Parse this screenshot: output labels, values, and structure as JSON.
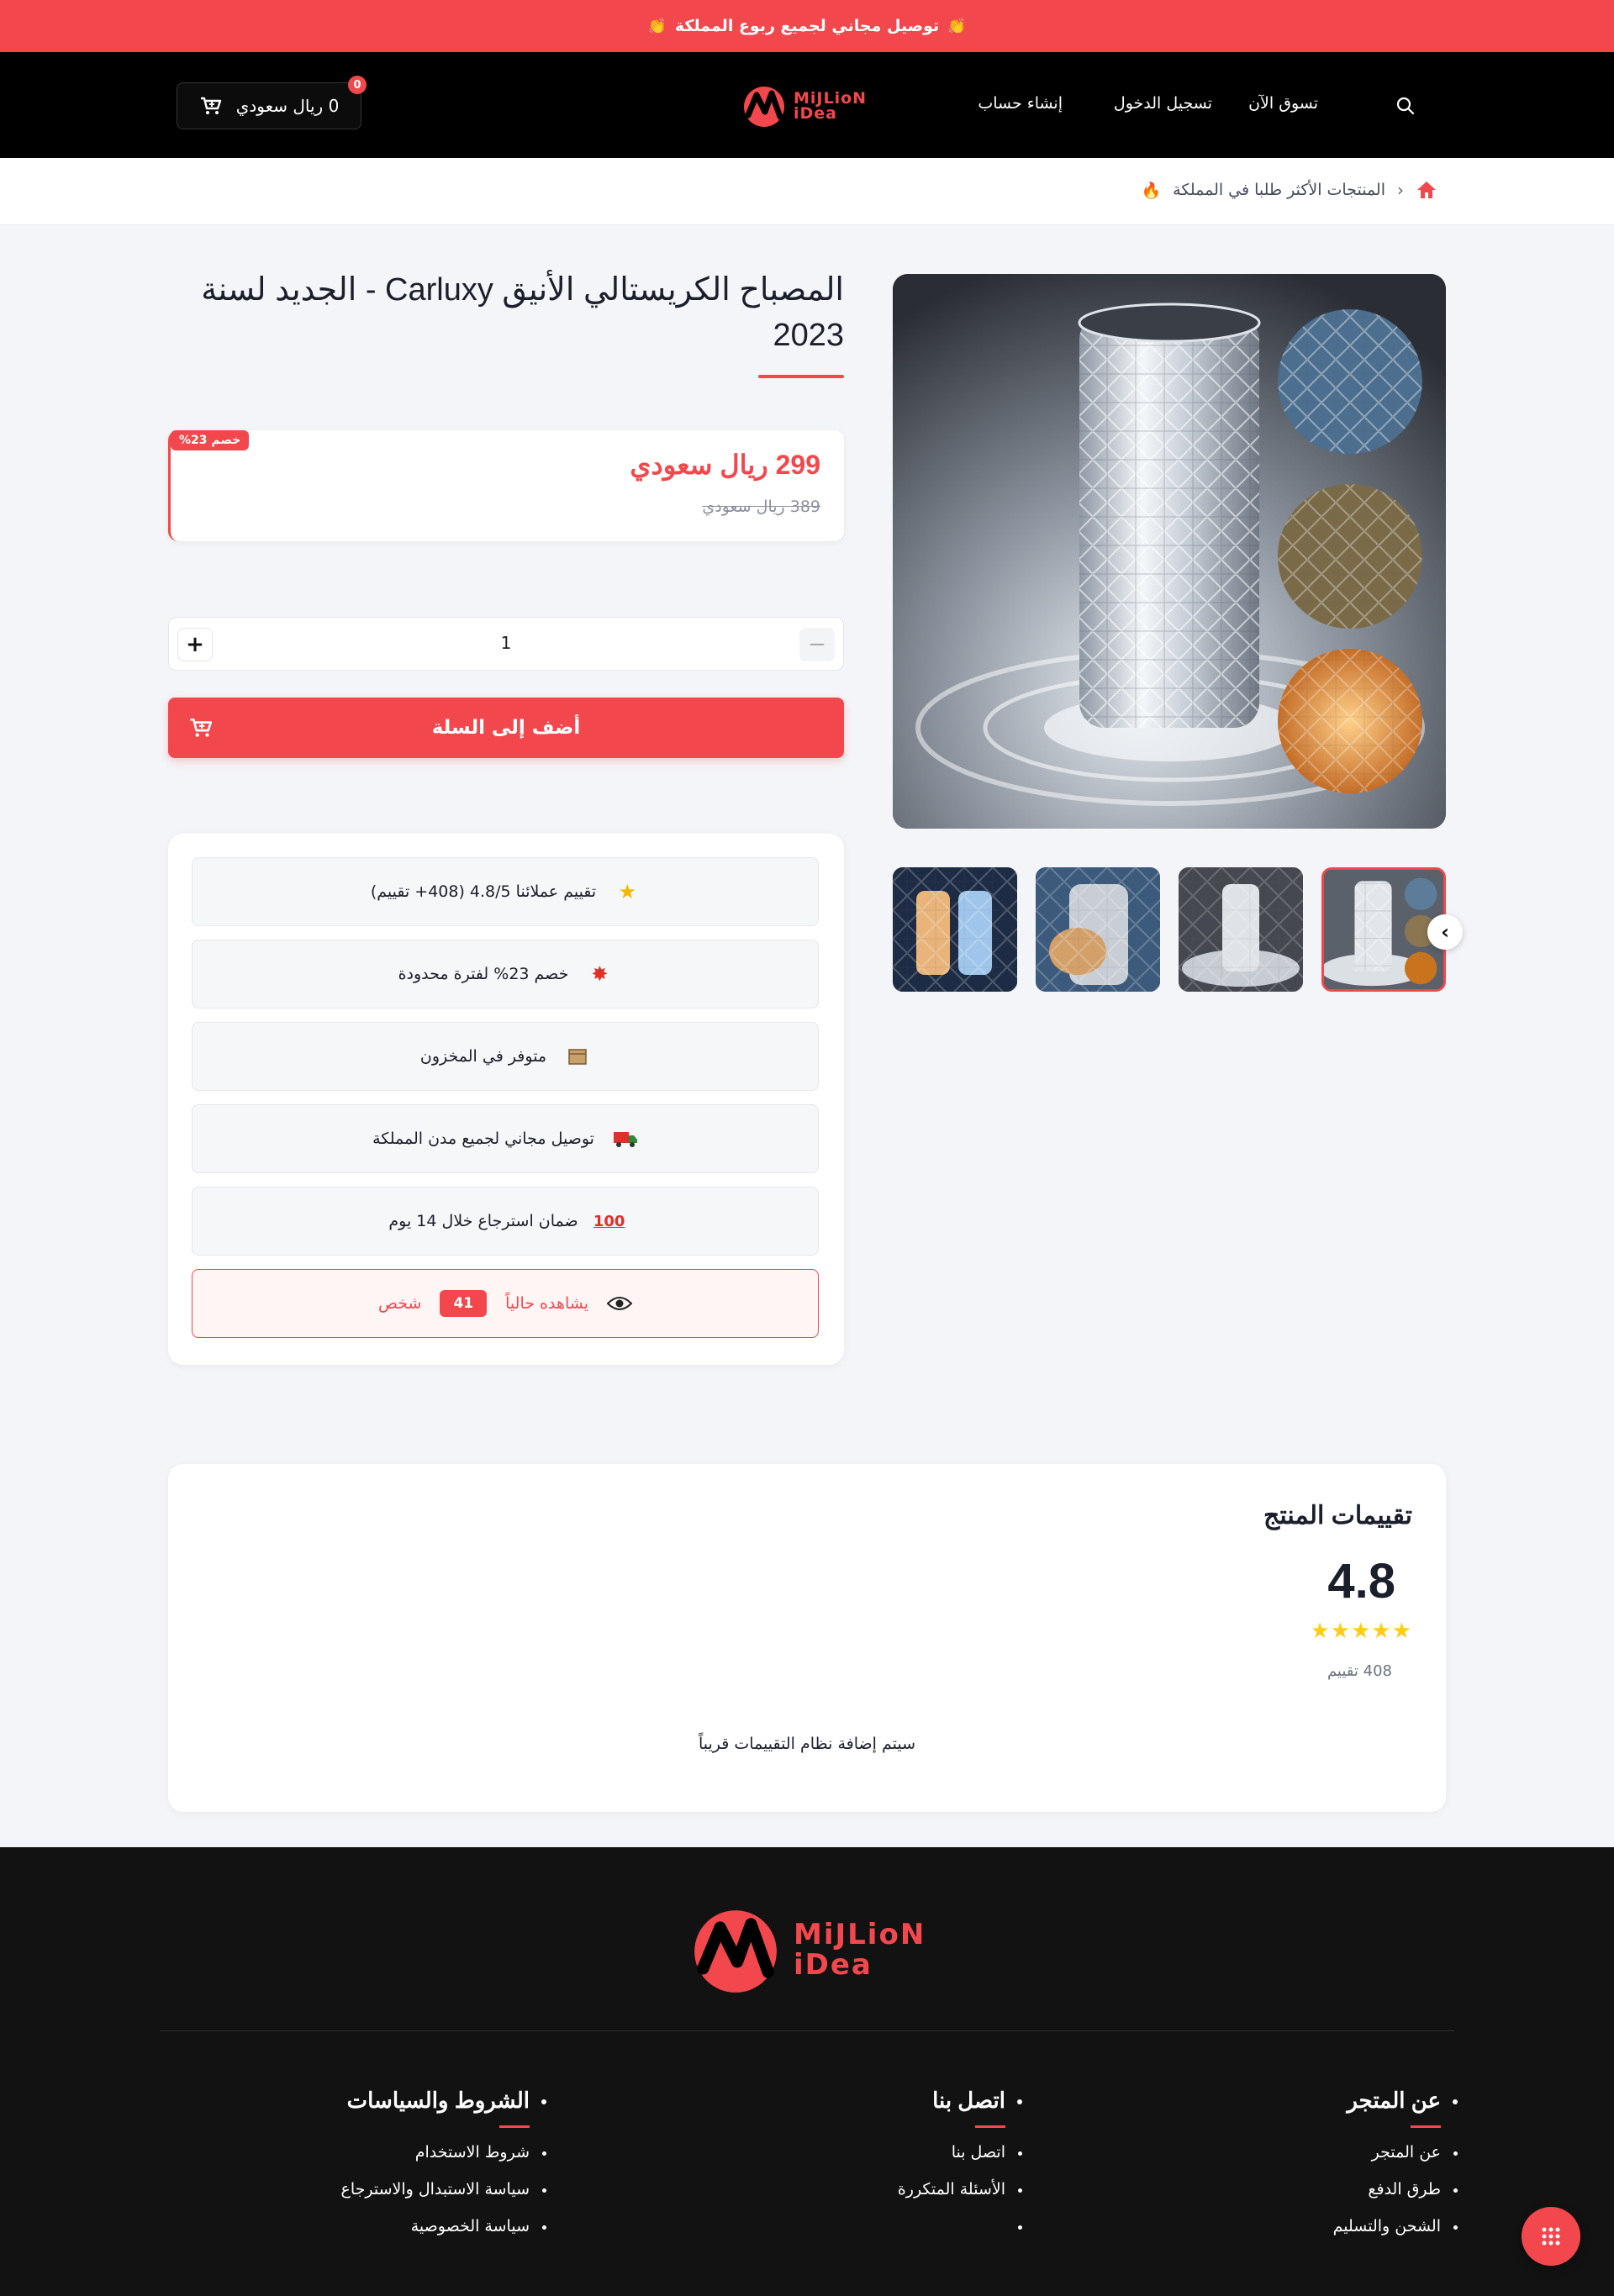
{
  "announcement": {
    "text": "توصيل مجاني لجميع ربوع المملكة",
    "emoji_left": "👏",
    "emoji_right": "👏"
  },
  "header": {
    "cart_label": "0 ريال سعودي",
    "cart_count": "0",
    "logo_text_line1": "MiJLioN",
    "logo_text_line2": "iDea",
    "nav": [
      "تسوق الآن",
      "تسجيل الدخول",
      "إنشاء حساب"
    ]
  },
  "breadcrumb": {
    "current": "المنتجات الأكثر طلبا في المملكة",
    "emoji": "🔥"
  },
  "product": {
    "title": "المصباح الكريستالي الأنيق Carluxy - الجديد لسنة 2023",
    "price_now": "299 ريال سعودي",
    "price_old": "389 ريال سعودي",
    "discount_tag": "خصم 23%",
    "quantity": "1",
    "add_to_cart": "أضف إلى السلة"
  },
  "features": [
    {
      "icon": "star-icon",
      "text": "تقييم عملائنا 4.8/5 (408+ تقييم)"
    },
    {
      "icon": "boom-icon",
      "text": "خصم 23% لفترة محدودة"
    },
    {
      "icon": "box-icon",
      "text": "متوفر في المخزون"
    },
    {
      "icon": "truck-icon",
      "text": "توصيل مجاني لجميع مدن المملكة"
    },
    {
      "icon": "hundred-icon",
      "text": "ضمان استرجاع خلال 14 يوم"
    }
  ],
  "live_viewers": {
    "prefix": "يشاهده حالياً",
    "count": "41",
    "suffix": "شخص"
  },
  "reviews": {
    "title": "تقييمات المنتج",
    "score": "4.8",
    "stars": 4.8,
    "count_label": "408 تقييم",
    "coming_soon": "سيتم إضافة نظام التقييمات قريباً"
  },
  "footer": {
    "columns": [
      {
        "title": "عن المتجر",
        "links": [
          "عن المتجر",
          "طرق الدفع",
          "الشحن والتسليم"
        ]
      },
      {
        "title": "اتصل بنا",
        "links": [
          "اتصل بنا",
          "الأسئلة المتكررة",
          ""
        ]
      },
      {
        "title": "الشروط والسياسات",
        "links": [
          "شروط الاستخدام",
          "سياسة الاستبدال والاسترجاع",
          "سياسة الخصوصية"
        ]
      }
    ]
  },
  "colors": {
    "accent": "#f2484d",
    "header_bg": "#000000",
    "footer_bg": "#121212",
    "star": "#ffcc1a"
  }
}
